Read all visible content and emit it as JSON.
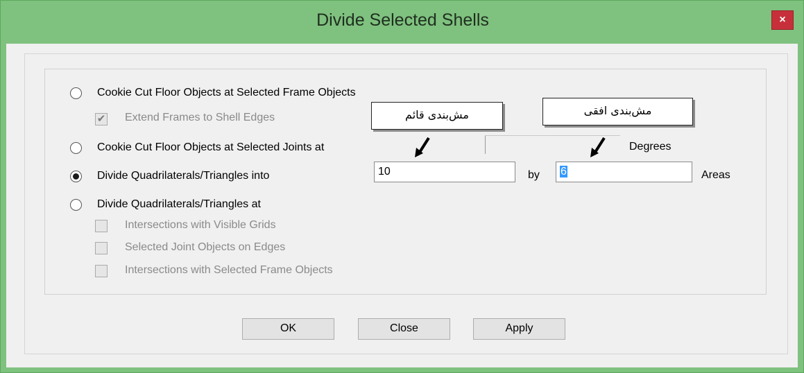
{
  "window": {
    "title": "Divide Selected Shells",
    "close_glyph": "×"
  },
  "options": {
    "cookie_frame_label": "Cookie Cut Floor Objects at Selected Frame Objects",
    "extend_frames_label": "Extend Frames to Shell Edges",
    "extend_frames_checked": true,
    "cookie_joints_label": "Cookie Cut Floor Objects at Selected Joints at",
    "degrees_label": "Degrees",
    "divide_into_label": "Divide Quadrilaterals/Triangles into",
    "divide_into_selected": true,
    "divide_value_1": "10",
    "by_label": "by",
    "divide_value_2": "6",
    "areas_label": "Areas",
    "divide_at_label": "Divide Quadrilaterals/Triangles at",
    "grids_label": "Intersections with Visible Grids",
    "joints_edges_label": "Selected Joint Objects on Edges",
    "frame_intersections_label": "Intersections with Selected Frame Objects"
  },
  "annotations": {
    "vertical_mesh": "مش‌بندی قائم",
    "horizontal_mesh": "مش‌بندی افقی"
  },
  "buttons": {
    "ok": "OK",
    "close": "Close",
    "apply": "Apply"
  },
  "colors": {
    "title_bar": "#7fc17f",
    "close_button": "#c7303a",
    "selection": "#3399ff"
  }
}
